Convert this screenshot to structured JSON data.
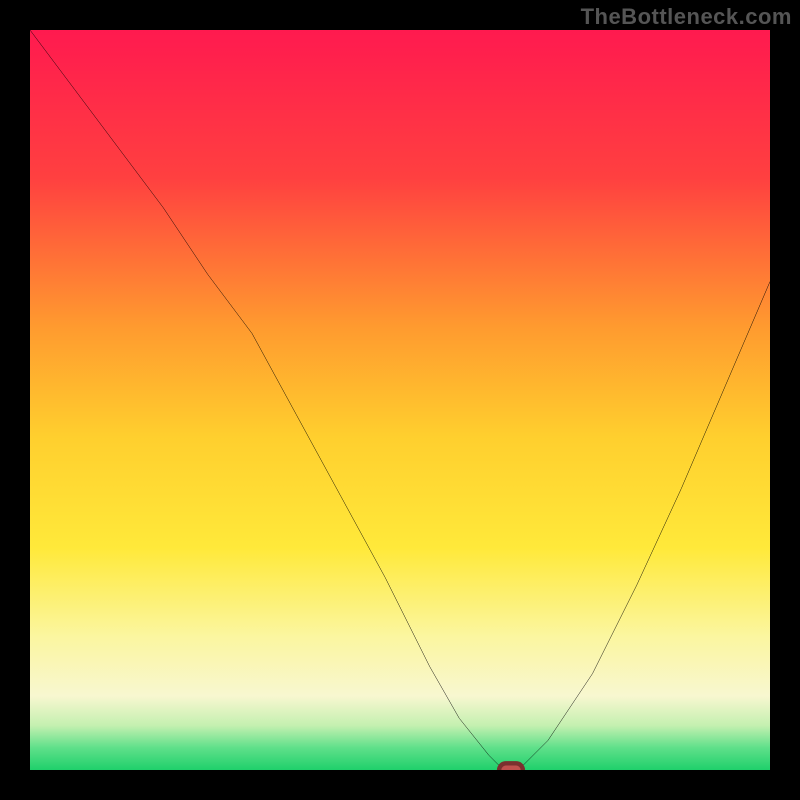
{
  "watermark": "TheBottleneck.com",
  "chart_data": {
    "type": "line",
    "title": "",
    "xlabel": "",
    "ylabel": "",
    "xlim": [
      0,
      100
    ],
    "ylim": [
      0,
      100
    ],
    "background_gradient": {
      "stops": [
        {
          "offset": 0,
          "color": "#ff1a4f"
        },
        {
          "offset": 20,
          "color": "#ff4040"
        },
        {
          "offset": 40,
          "color": "#ff9a2f"
        },
        {
          "offset": 55,
          "color": "#ffcf2e"
        },
        {
          "offset": 70,
          "color": "#ffe93a"
        },
        {
          "offset": 82,
          "color": "#fbf6a0"
        },
        {
          "offset": 90,
          "color": "#f8f7d0"
        },
        {
          "offset": 94,
          "color": "#c4f0b0"
        },
        {
          "offset": 97,
          "color": "#5fe08a"
        },
        {
          "offset": 100,
          "color": "#1fd06b"
        }
      ]
    },
    "series": [
      {
        "name": "bottleneck-curve",
        "x": [
          0,
          6,
          12,
          18,
          24,
          30,
          36,
          42,
          48,
          54,
          58,
          62,
          64,
          66,
          70,
          76,
          82,
          88,
          94,
          100
        ],
        "y": [
          100,
          92,
          84,
          76,
          67,
          59,
          48,
          37,
          26,
          14,
          7,
          2,
          0,
          0,
          4,
          13,
          25,
          38,
          52,
          66
        ]
      }
    ],
    "annotations": [
      {
        "name": "optimal-marker",
        "shape": "pill",
        "x": 65,
        "y": 0,
        "color": "#c0504d"
      }
    ]
  }
}
